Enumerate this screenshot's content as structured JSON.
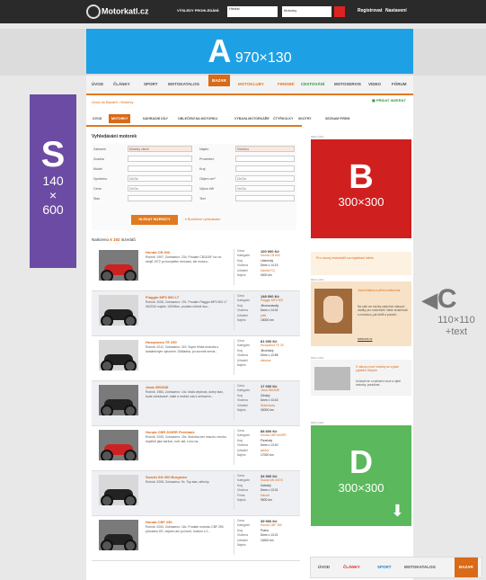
{
  "topbar": {
    "logo": "Motorkatl.cz",
    "search_label": "VÝSLEDY PROHLEDÁNÍ:",
    "search_value": "Hledat",
    "scope_value": "Motorky",
    "links": [
      "Registrovat",
      "Nastavení"
    ]
  },
  "ads": {
    "A": {
      "letter": "A",
      "size": "970×130"
    },
    "B": {
      "letter": "B",
      "size": "300×300"
    },
    "S": {
      "letter": "S",
      "size_lines": [
        "140",
        "×",
        "600"
      ]
    },
    "C": {
      "letter": "C",
      "size_lines": [
        "110×110",
        "+text"
      ]
    },
    "D": {
      "letter": "D",
      "size": "300×300"
    }
  },
  "mainnav": [
    "ÚVOD",
    "ČLÁNKY",
    "SPORT",
    "MOTOKATALOG",
    "BAZAR",
    "MOTOKLUBY",
    "FIREMNÍ",
    "CESTOVÁNÍ",
    "MOTOSERVIS",
    "VIDEO",
    "FÓRUM"
  ],
  "mainnav_active": "BAZAR",
  "breadcrumb": "Úvod do Bazarů › Motorky",
  "add_button": "PŘIDAT INZERÁT",
  "subtabs": [
    "ÚVOD",
    "MOTORKY",
    "NÁHRADNÍ DÍLY",
    "OBLEČENÍ NA MOTORKU",
    "VÝBAVA MOTORKÁŘE",
    "ČTYŘKOLKY",
    "SKÚTRY",
    "SEZNAM FIREM"
  ],
  "subtab_active": "MOTORKY",
  "search_panel": {
    "title": "Vyhledávání motorek",
    "left_fields": [
      {
        "label": "Zařazení",
        "value": "Motorky všech"
      },
      {
        "label": "Značka",
        "value": ""
      },
      {
        "label": "Model",
        "value": ""
      },
      {
        "label": "Vyrobeno",
        "value": "Od    Do"
      },
      {
        "label": "Cena",
        "value": "Od    Do"
      },
      {
        "label": "Stav",
        "value": ""
      }
    ],
    "right_fields": [
      {
        "label": "Najeto",
        "value": "Všechno"
      },
      {
        "label": "Provedení",
        "value": ""
      },
      {
        "label": "Kraj",
        "value": ""
      },
      {
        "label": "Objem cm³",
        "value": "Od    Do"
      },
      {
        "label": "Výkon kW",
        "value": "Od    Do"
      },
      {
        "label": "Text",
        "value": ""
      }
    ],
    "search_button": "HLEDAT INZERÁTY",
    "more_link": "▾ Rozšířené vyhledávání"
  },
  "found": {
    "prefix": "Nalezeno ",
    "count": "6 192",
    "suffix": " inzerátů"
  },
  "listings": [
    {
      "title": "Honda CB 600",
      "desc": "Ročník: 1997, Zobrazeno: 234. Prodám CB1100F na víc strojů 1972 po kompletní renovaci, stk motoru...",
      "attrs": [
        "Cena",
        "Kategorie",
        "Kraj",
        "Vložena",
        "Uživatel",
        "Najeto"
      ],
      "vals": [
        "100 000 Kč",
        "Honda CB 600",
        "Liberecký",
        "Dnes v 14:15",
        "Daniel(YC)",
        "0000 km"
      ]
    },
    {
      "title": "Piaggio MP3 500 LT",
      "desc": "Ročník: 2008, Zobrazeno: 191. Prodám Piaggio MP3 500 LT 06/2010 naježo 15000km, prodám včetně duo...",
      "attrs": [
        "Cena",
        "Kategorie",
        "Kraj",
        "Vložena",
        "Uživatel",
        "Najeto"
      ],
      "vals": [
        "148 000 Kč",
        "Piaggio MP3 500",
        "Jihomoravský",
        "Dnes v 14:02",
        "piett",
        "15000 km"
      ]
    },
    {
      "title": "Husqvarna TE 250",
      "desc": "Ročník: 2012, Zobrazeno: 119. Super lehká motorka s dostatečným výkonem. Důkladná, po sezóně servis...",
      "attrs": [
        "Cena",
        "Kategorie",
        "Kraj",
        "Vložena",
        "Uživatel",
        "Najeto"
      ],
      "vals": [
        "81 000 Kč",
        "Husqvarna TE 25",
        "Jihočeský",
        "Dnes v 13:58",
        "diesdoe",
        ""
      ]
    },
    {
      "title": "Jawa 350/638",
      "desc": "Ročník: 1984, Zobrazeno: 14x. Malá obytnost, dobrý stav, bude očekávané, máte a nechte nás k seriózním...",
      "attrs": [
        "Cena",
        "Kategorie",
        "Kraj",
        "Vložena",
        "Uživatel",
        "Najeto"
      ],
      "vals": [
        "17 000 Kč",
        "Jawa 350/638",
        "Zlínský",
        "Dnes v 13:43",
        "Sklenšanw",
        "00000 km"
      ]
    },
    {
      "title": "Honda CBR 600RR Fireblade",
      "desc": "Ročník: 2005, Zobrazeno: 15x. Motorka bez vmuzin, mnoho doplňků jako karbon, kufr, atd. Levo na...",
      "attrs": [
        "Cena",
        "Kategorie",
        "Kraj",
        "Vložena",
        "Uživatel",
        "Najeto"
      ],
      "vals": [
        "88 800 Kč",
        "Honda CBR 600RR",
        "Plzeňský",
        "Dnes v 13:40",
        "jakdoz",
        "17000 km"
      ]
    },
    {
      "title": "Suzuki AN 400 Burgman",
      "desc": "Ročník: 2008, Zobrazeno: 9x. Top stav, střechy.",
      "attrs": [
        "Cena",
        "Kategorie",
        "Kraj",
        "Vložena",
        "Firma",
        "Najeto"
      ],
      "vals": [
        "34 900 Kč",
        "Suzuki AN 400 B",
        "Ústecký",
        "Dnes v 13:31",
        "Harzal",
        "9000 km"
      ]
    },
    {
      "title": "Honda CBF 250",
      "desc": "Ročník: 2004, Zobrazeno: 16x. Prodám motorku CBF 250, původem DE, nejsem ani po bouři, funkční s 2...",
      "attrs": [
        "Cena",
        "Kategorie",
        "Kraj",
        "Vložena",
        "Uživatel",
        "Najeto"
      ],
      "vals": [
        "39 900 Kč",
        "Honda CBF 250",
        "Praha",
        "Dnes v 13:21",
        "",
        "16300 km"
      ]
    }
  ],
  "rail": {
    "reklama": "REKLAMA",
    "promo": "Pro rozvoj motorkářů na registraci Intelo",
    "adC_title": "Jízdní lékárny a přímo motorovna",
    "adC_text": "Na naší ver služby nabízíme nákupní zážitky pro motorkáře. Naše zkušenosti s motorkou, jak šetřit a poradit...",
    "adC_link": "www.xxx.cz",
    "adC2_title": "K nákupu nové motorky se vyplatí pojištění Simplex",
    "adC2_text": "Ucházet se o nabízení nové a ojeté motorky, poradíme..."
  },
  "bottomnav": [
    "ÚVOD",
    "ČLÁNKY",
    "SPORT",
    "MOTOKATALOG",
    "BAZAR"
  ],
  "bottomnav_active": "BAZAR"
}
